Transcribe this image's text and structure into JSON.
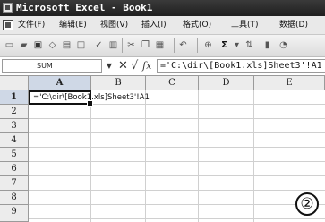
{
  "window": {
    "title": "Microsoft Excel - Book1"
  },
  "menubar": {
    "items": [
      {
        "label": "文件(F)"
      },
      {
        "label": "编辑(E)"
      },
      {
        "label": "视图(V)"
      },
      {
        "label": "插入(I)"
      },
      {
        "label": "格式(O)"
      },
      {
        "label": "工具(T)"
      },
      {
        "label": "数据(D)"
      }
    ]
  },
  "toolbar": {
    "icons": [
      "new-icon",
      "open-icon",
      "save-icon",
      "permission-icon",
      "print-icon",
      "print-preview-icon",
      "spelling-icon",
      "research-icon",
      "cut-icon",
      "copy-icon",
      "paste-icon",
      "undo-icon",
      "hyperlink-icon",
      "autosum-icon",
      "sort-ascending-icon",
      "chart-icon"
    ],
    "autosum_symbol": "Σ"
  },
  "formula_bar": {
    "name_box": "SUM",
    "dropdown_glyph": "▼",
    "cancel_glyph": "✕",
    "enter_glyph": "√",
    "insert_function_glyph": "fx",
    "formula": "='C:\\dir\\[Book1.xls]Sheet3'!A1"
  },
  "sheet": {
    "columns": [
      "A",
      "B",
      "C",
      "D",
      "E"
    ],
    "rows": [
      "1",
      "2",
      "3",
      "4",
      "5",
      "6",
      "7",
      "8",
      "9"
    ],
    "active_cell": {
      "column": "A",
      "row": "1"
    },
    "cell_a1_text": "='C:\\dir\\[Book1.xls]Sheet3'!A1"
  },
  "annotation": {
    "step_number": "②"
  },
  "colors": {
    "titlebar": "#2a2a2a",
    "header_background": "#ececec",
    "active_header": "#cfd8e6",
    "gridline": "#d0d0d0"
  }
}
